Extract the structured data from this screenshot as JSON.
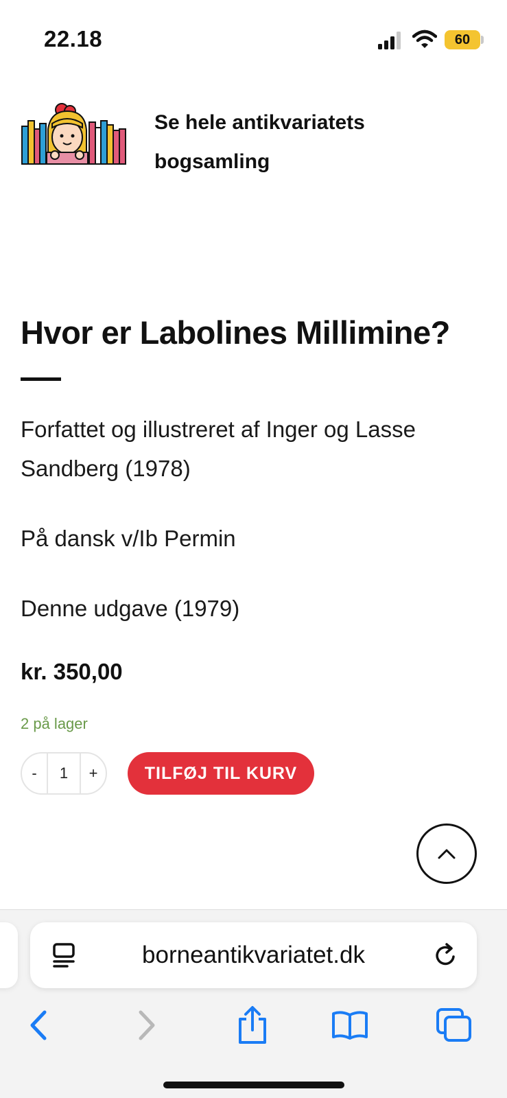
{
  "status_bar": {
    "time": "22.18",
    "battery": "60",
    "battery_color": "#f4c430",
    "icons": [
      "signal-icon",
      "wifi-icon",
      "battery-icon"
    ]
  },
  "header": {
    "logo": "bookshelf-girl-logo",
    "link_text": "Se hele antikvariatets bogsamling"
  },
  "product": {
    "title": "Hvor er Labolines Millimine?",
    "description": [
      "Forfattet og illustreret af Inger og Lasse Sandberg (1978)",
      "På dansk v/Ib Permin",
      "Denne udgave (1979)"
    ],
    "price": "kr. 350,00",
    "stock": "2 på lager",
    "quantity": {
      "minus": "-",
      "value": "1",
      "plus": "+"
    },
    "add_to_cart": "TILFØJ TIL KURV",
    "accent_color": "#e3313b",
    "stock_color": "#6a9a4a"
  },
  "scroll_top_icon": "chevron-up-icon",
  "browser": {
    "url": "borneantikvariatet.dk",
    "icons": [
      "reader-icon",
      "reload-icon",
      "back-icon",
      "forward-icon",
      "share-icon",
      "bookmarks-icon",
      "tabs-icon"
    ],
    "accent_color": "#1a7cf5"
  }
}
